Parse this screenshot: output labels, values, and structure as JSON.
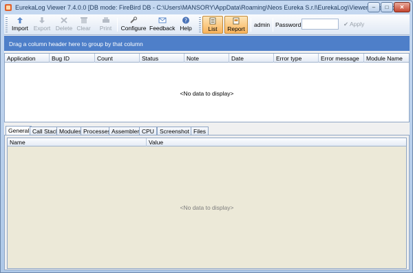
{
  "window": {
    "title": "EurekaLog Viewer 7.4.0.0 [DB mode: FireBird DB - C:\\Users\\MANSORY\\AppData\\Roaming\\Neos Eureka S.r.l\\EurekaLog\\Viewer\\eureka.fdb]",
    "minimize_glyph": "–",
    "maximize_glyph": "□",
    "close_glyph": "✕"
  },
  "toolbar": {
    "import": "Import",
    "export": "Export",
    "delete": "Delete",
    "clear": "Clear",
    "print": "Print",
    "configure": "Configure",
    "feedback": "Feedback",
    "help": "Help",
    "list": "List",
    "report": "Report",
    "user": "admin",
    "password_label": "Password",
    "password_value": "",
    "apply": "Apply"
  },
  "group_panel": {
    "text": "Drag a column header here to group by that column"
  },
  "grid": {
    "columns": [
      "Application",
      "Bug ID",
      "Count",
      "Status",
      "Note",
      "Date",
      "Error type",
      "Error message",
      "Module Name"
    ],
    "empty_text": "<No data to display>"
  },
  "tabs": [
    "General",
    "Call Stack",
    "Modules",
    "Processes",
    "Assembler",
    "CPU",
    "Screenshot",
    "Files"
  ],
  "active_tab": "General",
  "details": {
    "columns": [
      "Name",
      "Value"
    ],
    "empty_text": "<No data to display>"
  },
  "colors": {
    "group_panel_bg": "#4e7fc9",
    "active_toolbar_bg": "#f9b35a",
    "window_frame": "#aec8e8"
  }
}
